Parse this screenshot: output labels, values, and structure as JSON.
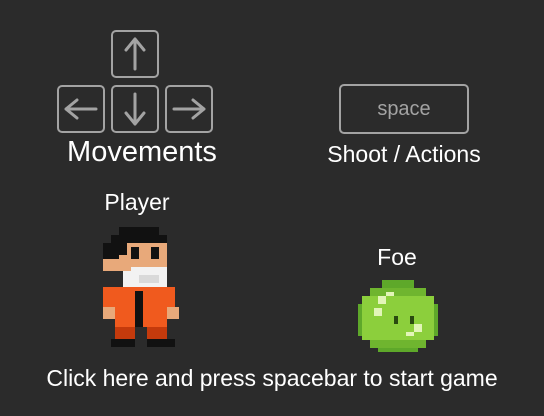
{
  "controls": {
    "movements_label": "Movements",
    "action_label": "Shoot / Actions",
    "space_key_label": "space",
    "arrow_keys": [
      "up",
      "left",
      "down",
      "right"
    ]
  },
  "characters": {
    "player_label": "Player",
    "foe_label": "Foe"
  },
  "start_prompt": "Click here and press spacebar to start game",
  "colors": {
    "background": "#2b2b2b",
    "key_border": "#a3a3a3",
    "text": "#ffffff",
    "player_suit": "#f05a1e",
    "foe_body": "#8ccf3c"
  }
}
